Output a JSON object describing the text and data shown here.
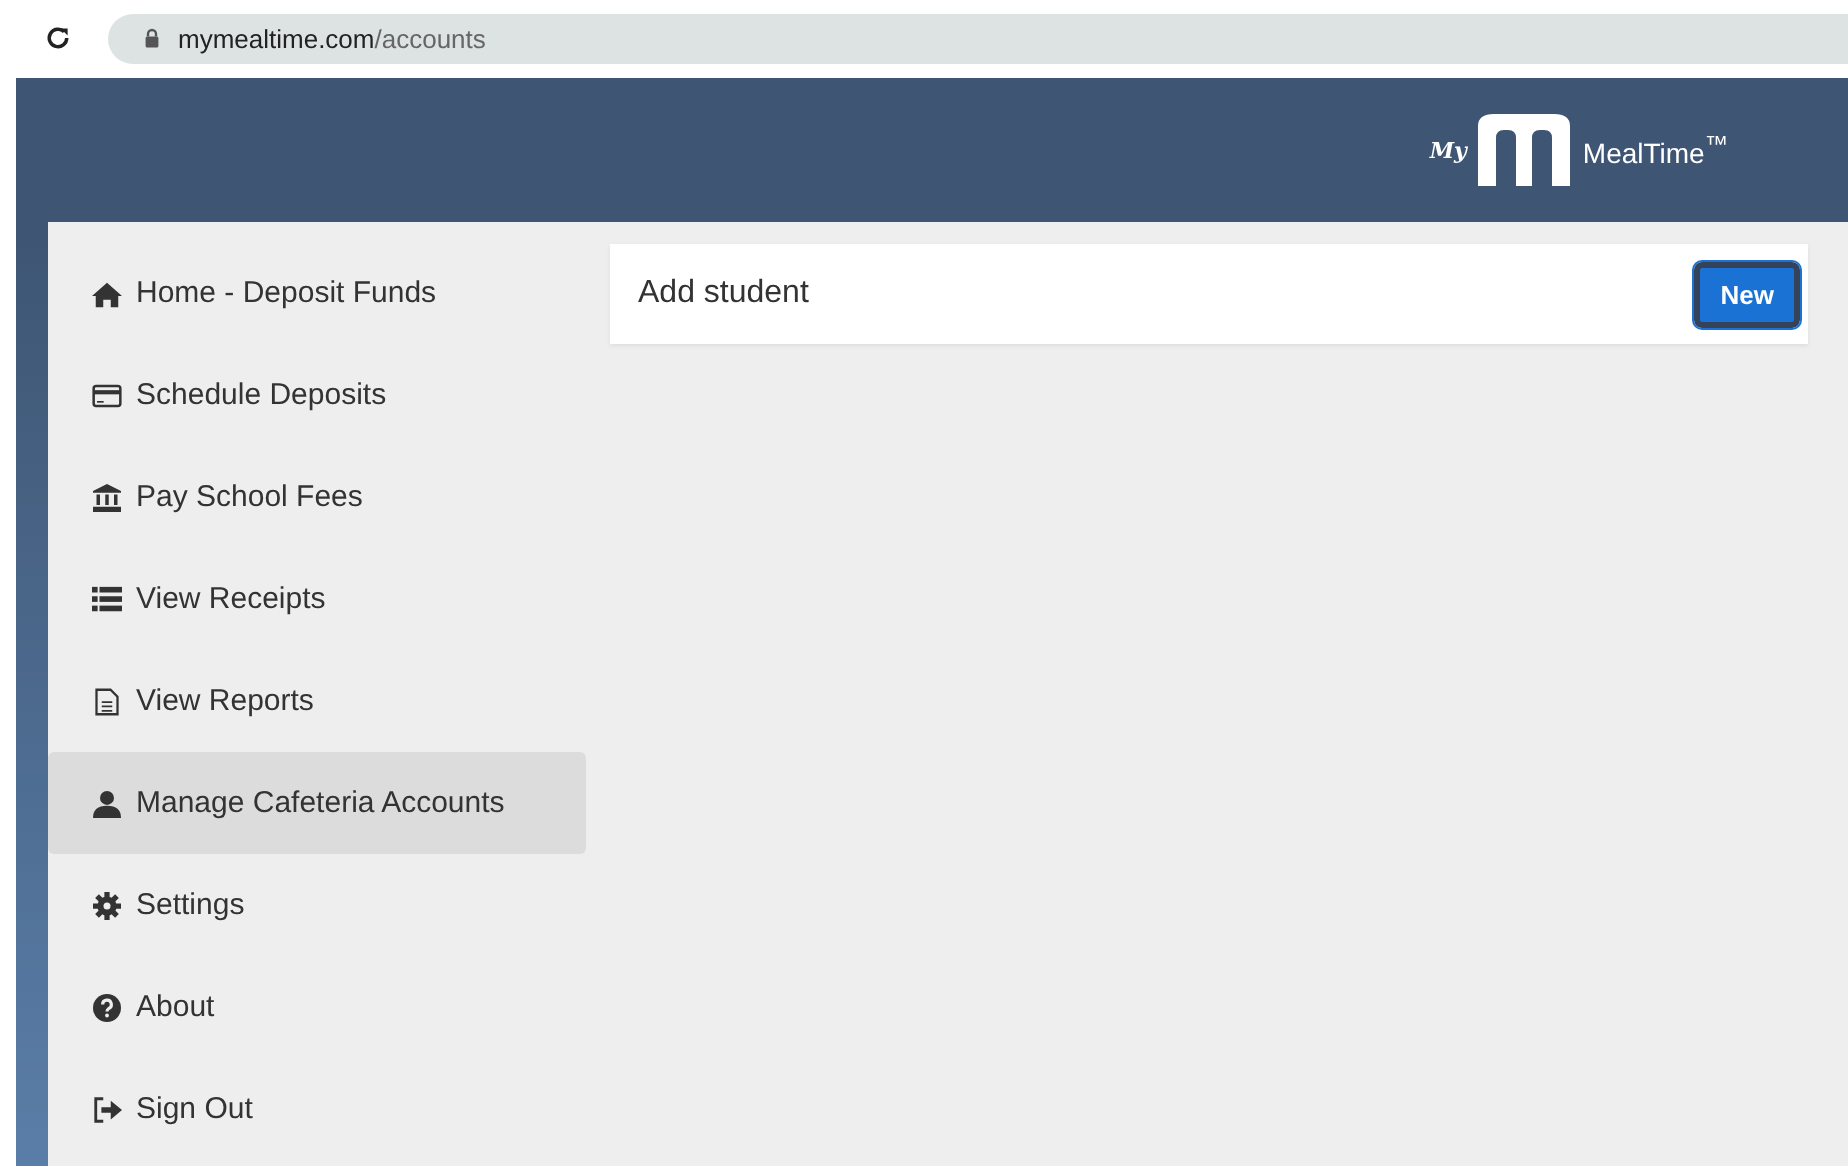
{
  "browser": {
    "address_host": "mymealtime.com",
    "address_path": "/accounts"
  },
  "header": {
    "logo_prefix": "My",
    "logo_name": "MealTime$^{™}$"
  },
  "sidebar": {
    "items": [
      {
        "label": "Home - Deposit Funds",
        "selected": false
      },
      {
        "label": "Schedule Deposits",
        "selected": false
      },
      {
        "label": "Pay School Fees",
        "selected": false
      },
      {
        "label": "View Receipts",
        "selected": false
      },
      {
        "label": "View Reports",
        "selected": false
      },
      {
        "label": "Manage Cafeteria Accounts",
        "selected": true
      },
      {
        "label": "Settings",
        "selected": false
      },
      {
        "label": "About",
        "selected": false
      },
      {
        "label": "Sign Out",
        "selected": false
      }
    ]
  },
  "panel": {
    "title": "Add student",
    "button": "New"
  }
}
